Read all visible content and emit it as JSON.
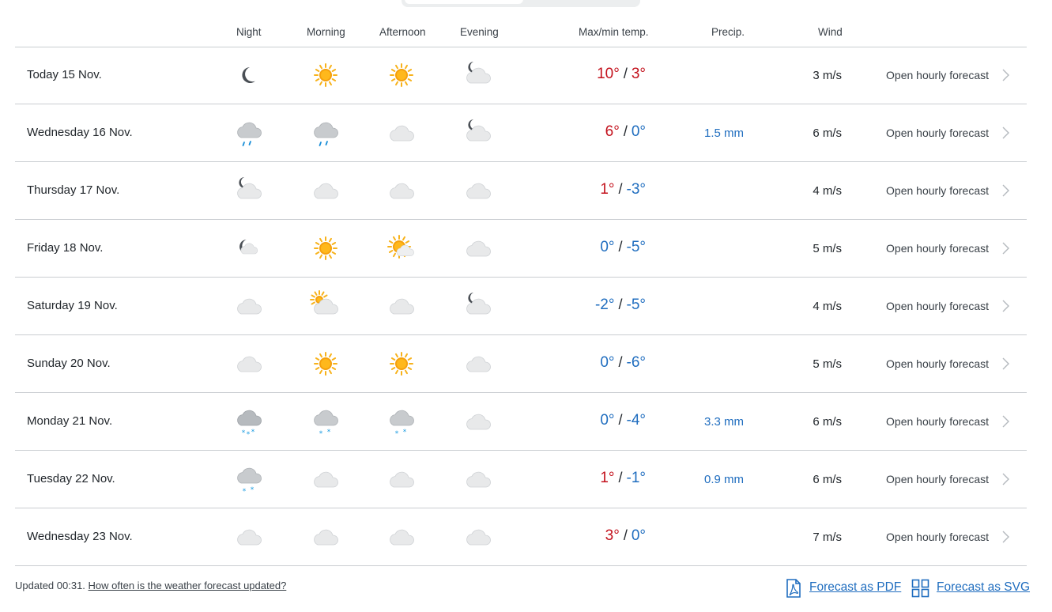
{
  "header": {
    "night": "Night",
    "morning": "Morning",
    "afternoon": "Afternoon",
    "evening": "Evening",
    "temp": "Max/min temp.",
    "precip": "Precip.",
    "wind": "Wind"
  },
  "rows": [
    {
      "day": "Today 15 Nov.",
      "icons": [
        "clear-night-icon",
        "sun-icon",
        "sun-icon",
        "partly-cloudy-night-icon"
      ],
      "hi": "10°",
      "lo": "3°",
      "hi_cls": "warm",
      "lo_cls": "warm",
      "precip": "",
      "wind": "3 m/s",
      "hourly": "Open hourly forecast"
    },
    {
      "day": "Wednesday 16 Nov.",
      "icons": [
        "light-rain-icon",
        "light-rain-icon",
        "cloud-icon",
        "partly-cloudy-night-icon"
      ],
      "hi": "6°",
      "lo": "0°",
      "hi_cls": "warm",
      "lo_cls": "cold",
      "precip": "1.5 mm",
      "wind": "6 m/s",
      "hourly": "Open hourly forecast"
    },
    {
      "day": "Thursday 17 Nov.",
      "icons": [
        "partly-cloudy-night-icon",
        "cloud-icon",
        "cloud-icon",
        "cloud-icon"
      ],
      "hi": "1°",
      "lo": "-3°",
      "hi_cls": "warm",
      "lo_cls": "cold",
      "precip": "",
      "wind": "4 m/s",
      "hourly": "Open hourly forecast"
    },
    {
      "day": "Friday 18 Nov.",
      "icons": [
        "fair-night-icon",
        "sun-icon",
        "fair-day-icon",
        "cloud-icon"
      ],
      "hi": "0°",
      "lo": "-5°",
      "hi_cls": "cold",
      "lo_cls": "cold",
      "precip": "",
      "wind": "5 m/s",
      "hourly": "Open hourly forecast"
    },
    {
      "day": "Saturday 19 Nov.",
      "icons": [
        "cloud-icon",
        "partly-cloudy-day-icon",
        "cloud-icon",
        "partly-cloudy-night-icon"
      ],
      "hi": "-2°",
      "lo": "-5°",
      "hi_cls": "cold",
      "lo_cls": "cold",
      "precip": "",
      "wind": "4 m/s",
      "hourly": "Open hourly forecast"
    },
    {
      "day": "Sunday 20 Nov.",
      "icons": [
        "cloud-icon",
        "sun-icon",
        "sun-icon",
        "cloud-icon"
      ],
      "hi": "0°",
      "lo": "-6°",
      "hi_cls": "cold",
      "lo_cls": "cold",
      "precip": "",
      "wind": "5 m/s",
      "hourly": "Open hourly forecast"
    },
    {
      "day": "Monday 21 Nov.",
      "icons": [
        "snow-icon",
        "light-snow-icon",
        "light-snow-icon",
        "cloud-icon"
      ],
      "hi": "0°",
      "lo": "-4°",
      "hi_cls": "cold",
      "lo_cls": "cold",
      "precip": "3.3 mm",
      "wind": "6 m/s",
      "hourly": "Open hourly forecast"
    },
    {
      "day": "Tuesday 22 Nov.",
      "icons": [
        "light-snow-icon",
        "cloud-icon",
        "cloud-icon",
        "cloud-icon"
      ],
      "hi": "1°",
      "lo": "-1°",
      "hi_cls": "warm",
      "lo_cls": "cold",
      "precip": "0.9 mm",
      "wind": "6 m/s",
      "hourly": "Open hourly forecast"
    },
    {
      "day": "Wednesday 23 Nov.",
      "icons": [
        "cloud-icon",
        "cloud-icon",
        "cloud-icon",
        "cloud-icon"
      ],
      "hi": "3°",
      "lo": "0°",
      "hi_cls": "warm",
      "lo_cls": "cold",
      "precip": "",
      "wind": "7 m/s",
      "hourly": "Open hourly forecast"
    }
  ],
  "footer": {
    "updated": "Updated 00:31.",
    "faq_link": "How often is the weather forecast updated?",
    "pdf_link": "Forecast as PDF",
    "svg_link": "Forecast as SVG"
  },
  "colors": {
    "warm": "#c3111c",
    "cold": "#1f6dbf",
    "link": "#1f6dbf",
    "divider": "#c9cdd1"
  }
}
